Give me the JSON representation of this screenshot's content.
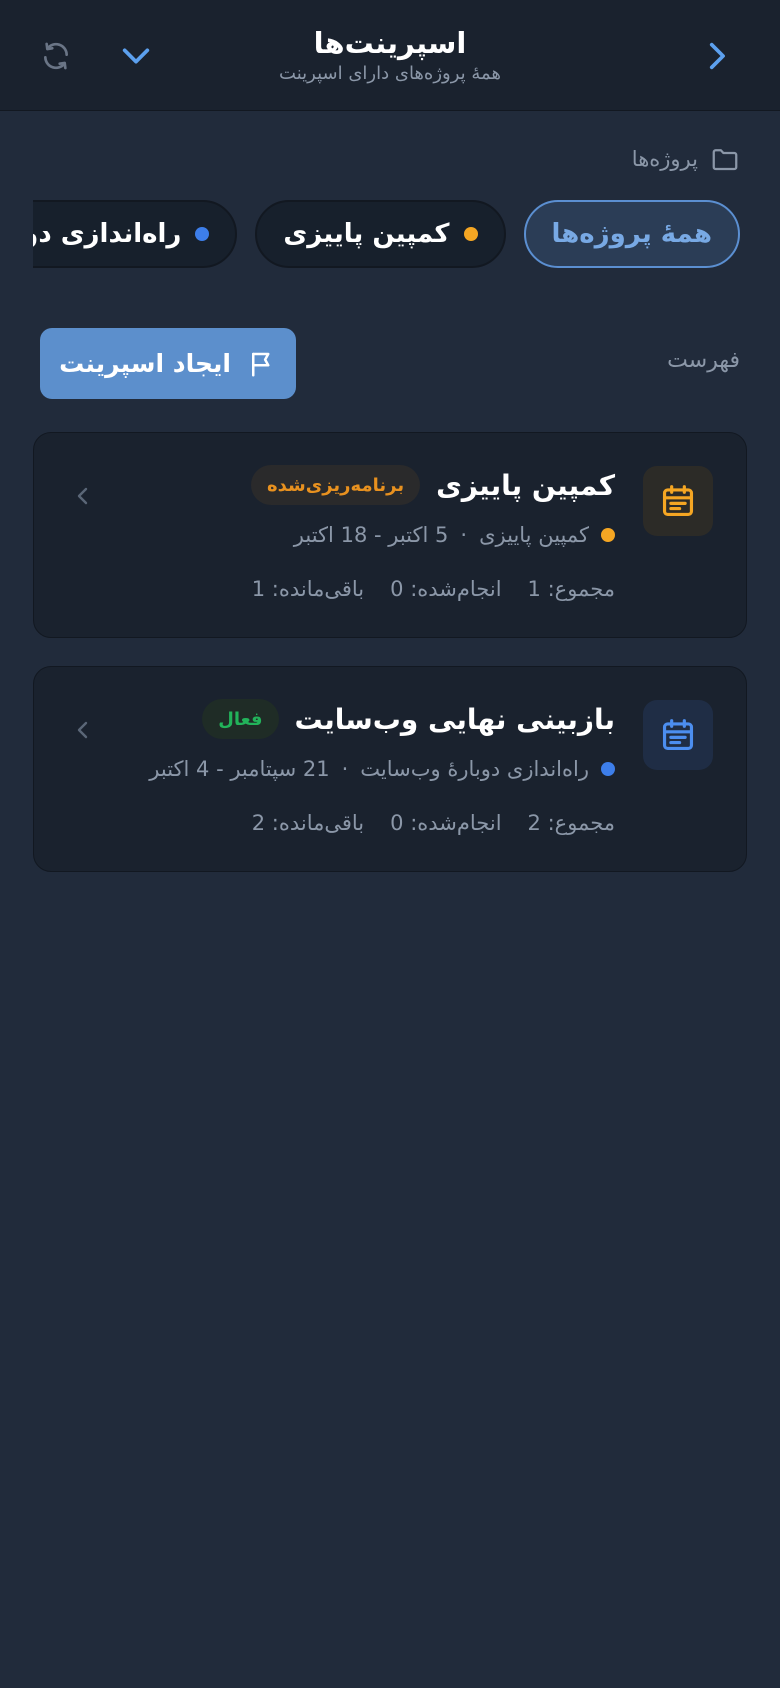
{
  "header": {
    "title": "اسپرینت‌ها",
    "subtitle": "همهٔ پروژه‌های دارای اسپرینت"
  },
  "projects_section": {
    "label": "پروژه‌ها"
  },
  "chips": [
    {
      "label": "همهٔ پروژه‌ها",
      "active": true,
      "dot_color": ""
    },
    {
      "label": "کمپین پاییزی",
      "active": false,
      "dot_color": "#f5a623"
    },
    {
      "label": "راه‌اندازی دوبارهٔ وب‌سایت",
      "active": false,
      "dot_color": "#3d7eea"
    }
  ],
  "list": {
    "label": "فهرست",
    "create_label": "ایجاد اسپرینت"
  },
  "sprints": [
    {
      "title": "کمپین پاییزی",
      "status": "برنامه‌ریزی‌شده",
      "status_color": "#e8911f",
      "status_bg": "#2a2a2b",
      "icon_color": "#f5a623",
      "icon_bg": "#2c2b27",
      "project": "کمپین پاییزی",
      "project_dot_color": "#f5a623",
      "date_range": "5 اکتبر - 18 اکتبر",
      "stats": {
        "total": "مجموع: 1",
        "done": "انجام‌شده: 0",
        "remaining": "باقی‌مانده: 1"
      }
    },
    {
      "title": "بازبینی نهایی وب‌سایت",
      "status": "فعال",
      "status_color": "#22b35a",
      "status_bg": "#1f2c26",
      "icon_color": "#4c8ef0",
      "icon_bg": "#1f2d45",
      "project": "راه‌اندازی دوبارهٔ وب‌سایت",
      "project_dot_color": "#3d7eea",
      "date_range": "21 سپتامبر - 4 اکتبر",
      "stats": {
        "total": "مجموع: 2",
        "done": "انجام‌شده: 0",
        "remaining": "باقی‌مانده: 2"
      }
    }
  ],
  "colors": {
    "accent": "#5b8fd1",
    "background": "#212b3b",
    "header_bg": "#1a222e",
    "card_bg": "#1a222e"
  }
}
